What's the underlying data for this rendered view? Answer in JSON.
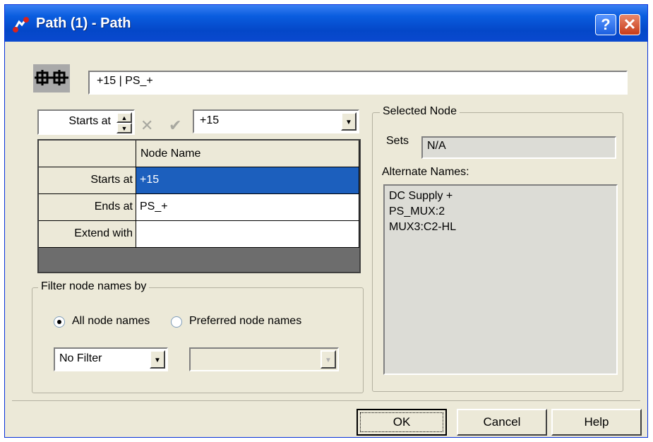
{
  "window": {
    "title": "Path (1) - Path",
    "help_label": "?",
    "close_label": "✕"
  },
  "path": {
    "value": "+15 | PS_+",
    "icon": "path-network-icon"
  },
  "toolbar": {
    "starts_label": "Starts at",
    "selected_value": "+15",
    "cancel_icon": "x-icon",
    "accept_icon": "check-icon"
  },
  "grid": {
    "column_header": "Node Name",
    "rows": [
      {
        "label": "Starts at",
        "value": "+15",
        "selected": true
      },
      {
        "label": "Ends at",
        "value": "PS_+",
        "selected": false
      },
      {
        "label": "Extend with",
        "value": "",
        "selected": false
      }
    ]
  },
  "filter": {
    "title": "Filter node names by",
    "option_all": "All node names",
    "option_preferred": "Preferred node names",
    "selected_option": "all",
    "filter_value": "No Filter",
    "second_value": ""
  },
  "selected_node": {
    "title": "Selected Node",
    "sets_label": "Sets",
    "sets_value": "N/A",
    "alternate_label": "Alternate Names:",
    "alternate_names": [
      "DC Supply +",
      "PS_MUX:2",
      "MUX3:C2-HL"
    ]
  },
  "buttons": {
    "ok": "OK",
    "cancel": "Cancel",
    "help": "Help"
  }
}
